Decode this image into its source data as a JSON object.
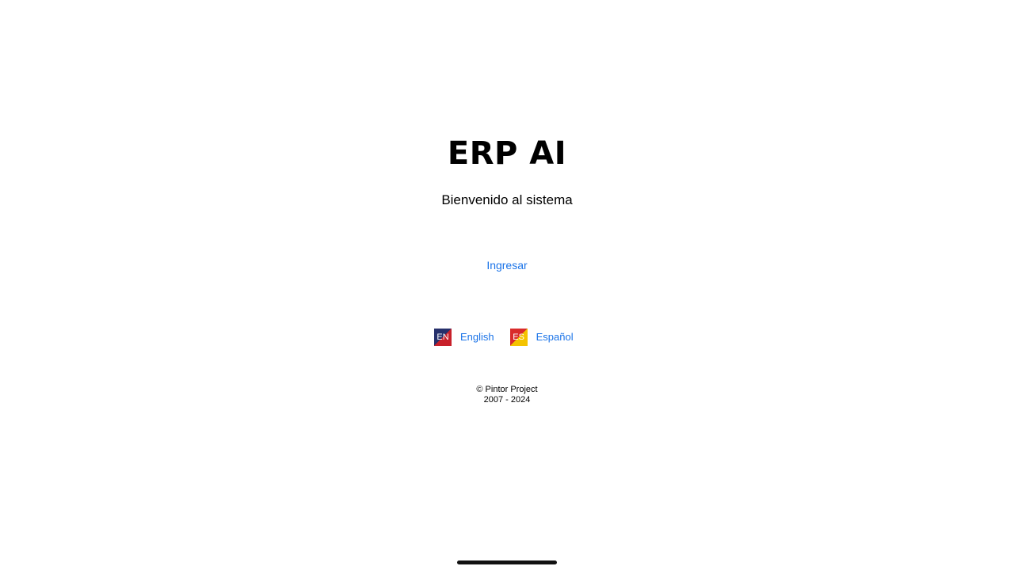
{
  "app": {
    "title": "ERP AI",
    "subtitle": "Bienvenido al sistema"
  },
  "actions": {
    "login_label": "Ingresar"
  },
  "languages": [
    {
      "code": "EN",
      "label": "English",
      "icon": "flag-en-icon"
    },
    {
      "code": "ES",
      "label": "Español",
      "icon": "flag-es-icon"
    }
  ],
  "footer": {
    "copyright": "© Pintor Project",
    "years": "2007 - 2024"
  },
  "colors": {
    "link": "#1a73e8",
    "text": "#000000",
    "background": "#ffffff"
  }
}
